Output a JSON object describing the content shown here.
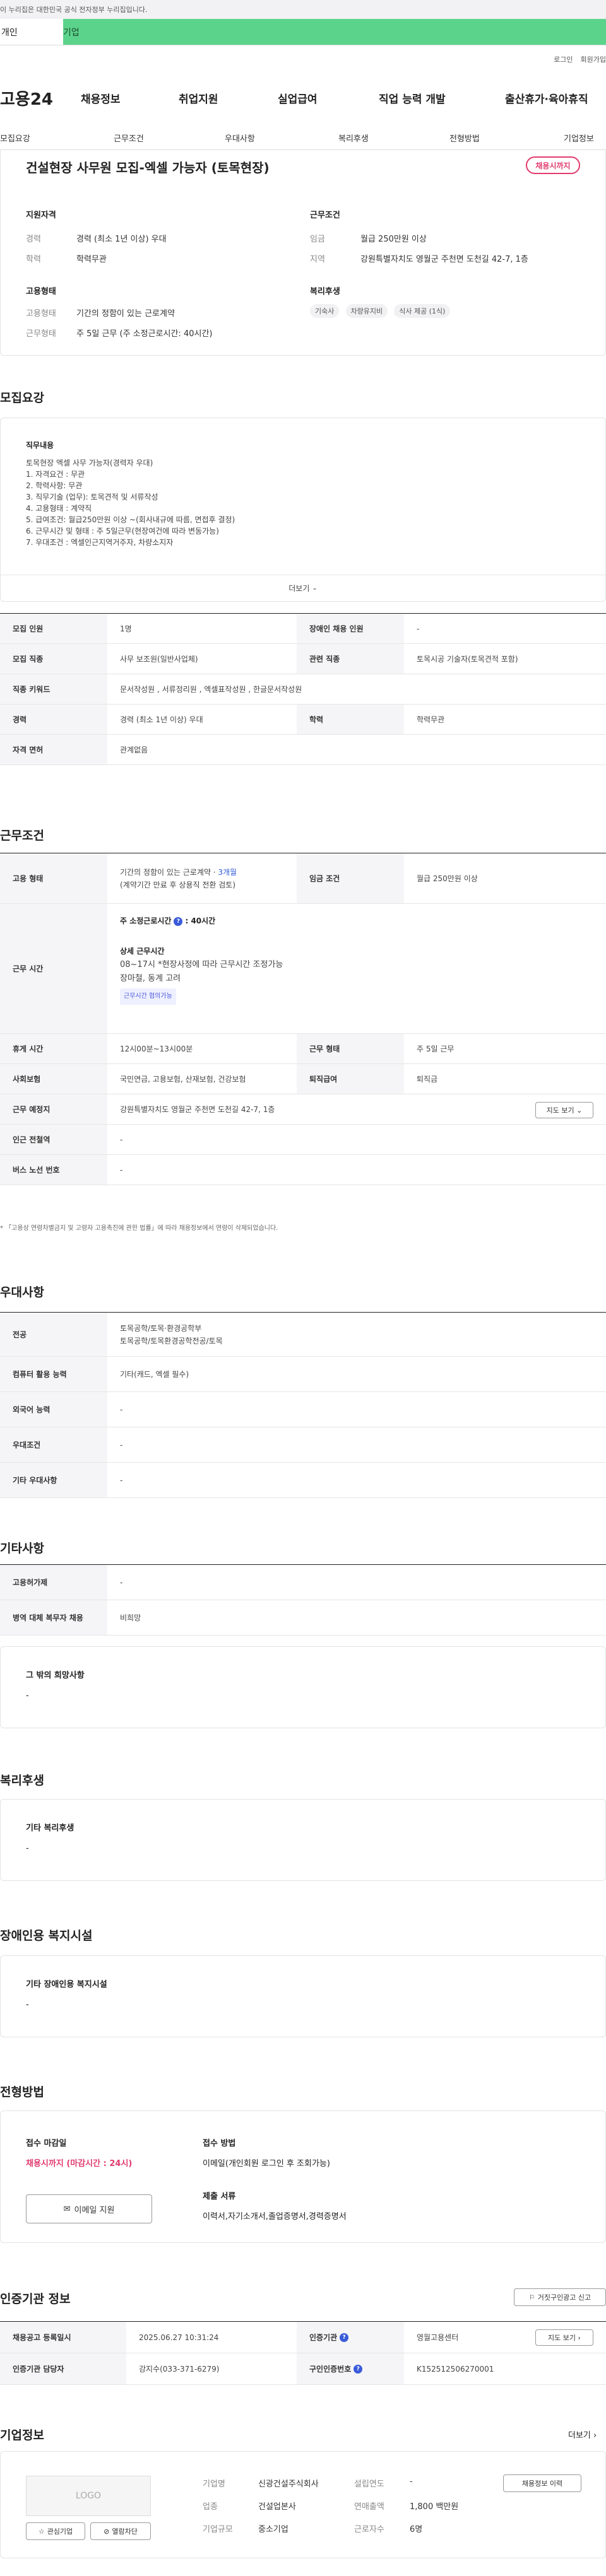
{
  "gov_banner": "이 누리집은 대한민국 공식 전자정부 누리집입니다.",
  "user_tabs": [
    "개인",
    "기업"
  ],
  "top_util": [
    "로그인",
    "회원가입"
  ],
  "site_logo": "고용24",
  "gnb": [
    "채용정보",
    "취업지원",
    "실업급여",
    "직업 능력 개발",
    "출산휴가·육아휴직"
  ],
  "subnav": [
    "모집요강",
    "근무조건",
    "우대사항",
    "복리후생",
    "전형방법",
    "기업정보"
  ],
  "job": {
    "title": "건설현장 사무원 모집-엑셀 가능자 (토목현장)",
    "status_badge": "채용시까지",
    "qualification_heading": "지원자격",
    "experience_label": "경력",
    "experience_value": "경력 (최소 1년 이상) 우대",
    "education_label": "학력",
    "education_value": "학력무관",
    "conditions_heading": "근무조건",
    "wage_label": "임금",
    "wage_value": "월급 250만원 이상",
    "location_label": "지역",
    "location_value": "강원특별자치도 영월군 주천면 도천길 42-7, 1층",
    "employment_heading": "고용형태",
    "emp_type_label": "고용형태",
    "emp_type_value": "기간의 정함이 있는 근로계약",
    "work_type_label": "근무형태",
    "work_type_value": "주 5일 근무 (주 소정근로시간: 40시간)",
    "benefits_heading": "복리후생",
    "benefit_tags": [
      "기숙사",
      "차량유지비",
      "식사 제공 (1식)"
    ]
  },
  "recruit": {
    "heading": "모집요강",
    "duty_heading": "직무내용",
    "duty_lines": [
      "토목현장 엑셀 사무 가능자(경력자 우대)",
      "1. 자격요건 : 무관",
      "2. 학력사항: 무관",
      "3. 직무기술 (업무): 토목견적 및 서류작성",
      "4. 고용형태 : 계약직",
      "5. 급여조건: 월급250만원 이상 ~(회사내규에 따름, 면접후 결정)",
      "6. 근무시간 및 형태 : 주 5일근무(현장여건에 따라 변동가능)",
      "7. 우대조건 : 엑셀인근지역거주자, 차량소지자"
    ],
    "more_label": "더보기",
    "rows": {
      "headcount_label": "모집 인원",
      "headcount": "1명",
      "disabled_label": "장애인 채용 인원",
      "disabled": "-",
      "job_label": "모집 직종",
      "job": "사무 보조원(일반사업체)",
      "related_label": "관련 직종",
      "related": "토목시공 기술자(토목견적 포함)",
      "keyword_label": "직종 키워드",
      "keyword": "문서작성원 , 서류정리원 , 엑셀표작성원 , 한글문서작성원",
      "career_label": "경력",
      "career": "경력 (최소 1년 이상) 우대",
      "edu_label": "학력",
      "edu": "학력무관",
      "license_label": "자격 면허",
      "license": "관계없음"
    }
  },
  "work": {
    "heading": "근무조건",
    "emp_label": "고용 형태",
    "emp_line1": "기간의 정함이 있는 근로계약 · ",
    "emp_duration": "3개월",
    "emp_line2": "(계약기간 만료 후 상용직 전환 검토)",
    "wage_label": "임금 조건",
    "wage": "월급 250만원 이상",
    "hours_label": "근무 시간",
    "hours_title": "주 소정근로시간",
    "hours_value": ": 40시간",
    "detail_title": "상세 근무시간",
    "detail_line1": "08~17시 *현장사정에 따라 근무시간 조정가능",
    "detail_line2": "장마철, 동계 고려",
    "adjust_tag": "근무시간 협의가능",
    "break_label": "휴게 시간",
    "break": "12시00분~13시00분",
    "form_label": "근무 형태",
    "form": "주 5일 근무",
    "insurance_label": "사회보험",
    "insurance": "국민연금, 고용보험, 산재보험, 건강보험",
    "retire_label": "퇴직급여",
    "retire": "퇴직금",
    "place_label": "근무 예정지",
    "place": "강원특별자치도 영월군 주천면 도천길 42-7, 1층",
    "map_btn": "지도 보기",
    "station_label": "인근 전철역",
    "station": "-",
    "bus_label": "버스 노선 번호",
    "bus": "-",
    "footnote": "「고용상 연령차별금지 및 고령자 고용촉진에 관한 법률」에 따라 채용정보에서 연령이 삭제되었습니다."
  },
  "preference": {
    "heading": "우대사항",
    "major_label": "전공",
    "major1": "토목공학/토목·환경공학부",
    "major2": "토목공학/토목환경공학전공/토목",
    "pc_label": "컴퓨터 활용 능력",
    "pc": "기타(캐드, 엑셀 필수)",
    "lang_label": "외국어 능력",
    "lang": "-",
    "cond_label": "우대조건",
    "cond": "-",
    "etc_label": "기타 우대사항",
    "etc": "-"
  },
  "etc": {
    "heading": "기타사항",
    "employ_label": "고용허가제",
    "employ": "-",
    "military_label": "병역 대체 복무자 채용",
    "military": "비희망",
    "hope_heading": "그 밖의 희망사항",
    "hope": "-"
  },
  "welfare": {
    "heading": "복리후생",
    "sub": "기타 복리후생",
    "value": "-"
  },
  "disabled_facility": {
    "heading": "장애인용 복지시설",
    "sub": "기타 장애인용 복지시설",
    "value": "-"
  },
  "selection": {
    "heading": "전형방법",
    "deadline_label": "접수 마감일",
    "deadline": "채용시까지 (마감시간 : 24시)",
    "method_label": "접수 방법",
    "method": "이메일(개인회원 로그인 후 조회가능)",
    "docs_label": "제출 서류",
    "docs": "이력서,자기소개서,졸업증명서,경력증명서",
    "email_btn": "이메일 지원"
  },
  "agency": {
    "heading": "인증기관 정보",
    "report_btn": "거짓구인광고 신고",
    "reg_label": "채용공고 등록일시",
    "reg": "2025.06.27 10:31:24",
    "org_label": "인증기관",
    "org": "영월고용센터",
    "staff_label": "인증기관 담당자",
    "staff": "강지수(033-371-6279)",
    "num_label": "구인인증번호",
    "num": "K152512506270001",
    "map_btn": "지도 보기"
  },
  "company": {
    "heading": "기업정보",
    "more": "더보기",
    "logo": "LOGO",
    "interest_btn": "관심기업",
    "block_btn": "열람차단",
    "name_label": "기업명",
    "name": "신광건설주식회사",
    "industry_label": "업종",
    "industry": "건설업본사",
    "size_label": "기업규모",
    "size": "중소기업",
    "year_label": "설립연도",
    "year": "-",
    "sales_label": "연매출액",
    "sales": "1,800 백만원",
    "workers_label": "근로자수",
    "workers": "6명",
    "jobs_btn": "채용정보 이력"
  }
}
